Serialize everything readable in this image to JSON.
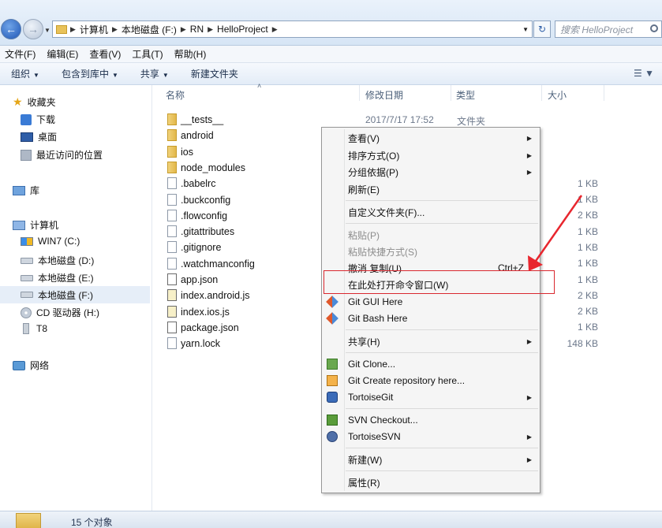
{
  "address": {
    "crumbs": [
      "计算机",
      "本地磁盘 (F:)",
      "RN",
      "HelloProject"
    ],
    "search_placeholder": "搜索 HelloProject"
  },
  "menubar": [
    "文件(F)",
    "编辑(E)",
    "查看(V)",
    "工具(T)",
    "帮助(H)"
  ],
  "toolbar": {
    "organize": "组织",
    "include_library": "包含到库中",
    "share": "共享",
    "new_folder": "新建文件夹"
  },
  "nav": {
    "favorites": "收藏夹",
    "downloads": "下载",
    "desktop": "桌面",
    "recent": "最近访问的位置",
    "libraries": "库",
    "computer": "计算机",
    "win7": "WIN7 (C:)",
    "disk_d": "本地磁盘 (D:)",
    "disk_e": "本地磁盘 (E:)",
    "disk_f": "本地磁盘 (F:)",
    "cd": "CD 驱动器 (H:)",
    "t8": "T8",
    "network": "网络"
  },
  "columns": {
    "name": "名称",
    "date": "修改日期",
    "type": "类型",
    "size": "大小"
  },
  "files": [
    {
      "name": "__tests__",
      "kind": "folder",
      "date": "2017/7/17 17:52",
      "type": "文件夹",
      "size": ""
    },
    {
      "name": "android",
      "kind": "folder",
      "size": ""
    },
    {
      "name": "ios",
      "kind": "folder",
      "size": ""
    },
    {
      "name": "node_modules",
      "kind": "folder",
      "size": ""
    },
    {
      "name": ".babelrc",
      "kind": "file",
      "size": "1 KB"
    },
    {
      "name": ".buckconfig",
      "kind": "file",
      "size": "1 KB"
    },
    {
      "name": ".flowconfig",
      "kind": "file",
      "size": "2 KB"
    },
    {
      "name": ".gitattributes",
      "kind": "file",
      "size": "1 KB"
    },
    {
      "name": ".gitignore",
      "kind": "file",
      "size": "1 KB"
    },
    {
      "name": ".watchmanconfig",
      "kind": "file",
      "size": "1 KB"
    },
    {
      "name": "app.json",
      "kind": "json",
      "size": "1 KB"
    },
    {
      "name": "index.android.js",
      "kind": "js",
      "size": "2 KB"
    },
    {
      "name": "index.ios.js",
      "kind": "js",
      "size": "2 KB"
    },
    {
      "name": "package.json",
      "kind": "json",
      "size": "1 KB"
    },
    {
      "name": "yarn.lock",
      "kind": "file",
      "size": "148 KB"
    }
  ],
  "status": {
    "count": "15 个对象"
  },
  "context_menu": {
    "view": "查看(V)",
    "sort": "排序方式(O)",
    "group": "分组依据(P)",
    "refresh": "刷新(E)",
    "customize": "自定义文件夹(F)...",
    "paste": "粘贴(P)",
    "paste_shortcut": "粘贴快捷方式(S)",
    "undo": "撤消 复制(U)",
    "undo_shortcut": "Ctrl+Z",
    "open_cmd": "在此处打开命令窗口(W)",
    "git_gui": "Git GUI Here",
    "git_bash": "Git Bash Here",
    "share": "共享(H)",
    "git_clone": "Git Clone...",
    "git_create": "Git Create repository here...",
    "tortoisegit": "TortoiseGit",
    "svn_checkout": "SVN Checkout...",
    "tortoisesvn": "TortoiseSVN",
    "new": "新建(W)",
    "properties": "属性(R)"
  },
  "colors": {
    "highlight_box": "#d9282f",
    "arrow": "#e8262e"
  }
}
